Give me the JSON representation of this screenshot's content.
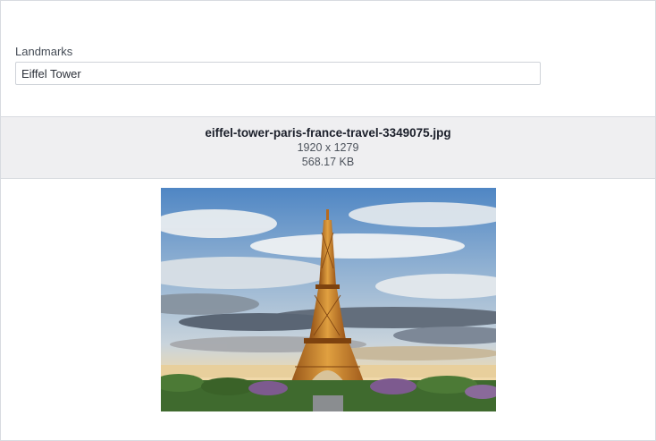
{
  "field": {
    "label": "Landmarks",
    "value": "Eiffel Tower"
  },
  "file": {
    "name": "eiffel-tower-paris-france-travel-3349075.jpg",
    "dimensions": "1920 x 1279",
    "size": "568.17 KB"
  },
  "preview": {
    "subject": "eiffel-tower-photo",
    "colors": {
      "sky_top": "#4f86c4",
      "sky_mid": "#a9c0d6",
      "horizon": "#f2d9a8",
      "cloud_light": "#e8ecef",
      "cloud_dark": "#55606f",
      "tower": "#b86a1c",
      "tower_light": "#e0a040",
      "trees": "#3f6a2e",
      "trees_purple": "#7d5a8f"
    }
  }
}
